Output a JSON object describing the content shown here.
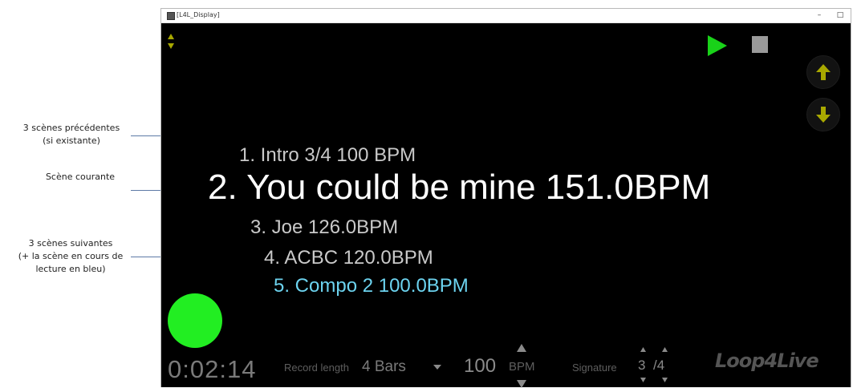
{
  "annotations": {
    "previous": "3 scènes précédentes\n(si existante)",
    "current": "Scène courante",
    "next": "3 scènes suivantes\n(+ la scène en cours de\nlecture en bleu)"
  },
  "window": {
    "title": "[L4L_Display]",
    "minimize": "–",
    "maximize": "□"
  },
  "scenes": {
    "previous": [
      "1. Intro 3/4 100 BPM"
    ],
    "current": "2. You could be mine 151.0BPM",
    "next": [
      "3. Joe 126.0BPM",
      "4. ACBC 120.0BPM",
      "5. Compo 2 100.0BPM"
    ]
  },
  "colors": {
    "background": "#000000",
    "scene_dim": "#c9c9c9",
    "scene_current": "#ffffff",
    "scene_playing": "#6cd3ef",
    "play": "#19d219",
    "record": "#22ee22",
    "arrow": "#a8a800",
    "muted_text": "#6a6a6a"
  },
  "icons": {
    "sort_toggle": "sort-arrows-icon",
    "play": "play-icon",
    "stop": "stop-icon",
    "scroll_up": "arrow-up-icon",
    "scroll_down": "arrow-down-icon",
    "record": "record-icon"
  },
  "bottom_bar": {
    "timer": "0:02:14",
    "record_length_label": "Record length",
    "record_length_value": "4 Bars",
    "tempo_value": "100",
    "tempo_unit": "BPM",
    "signature_label": "Signature",
    "signature_numerator": "3",
    "signature_denominator": "/4",
    "logo_text": "Loop4Live"
  }
}
